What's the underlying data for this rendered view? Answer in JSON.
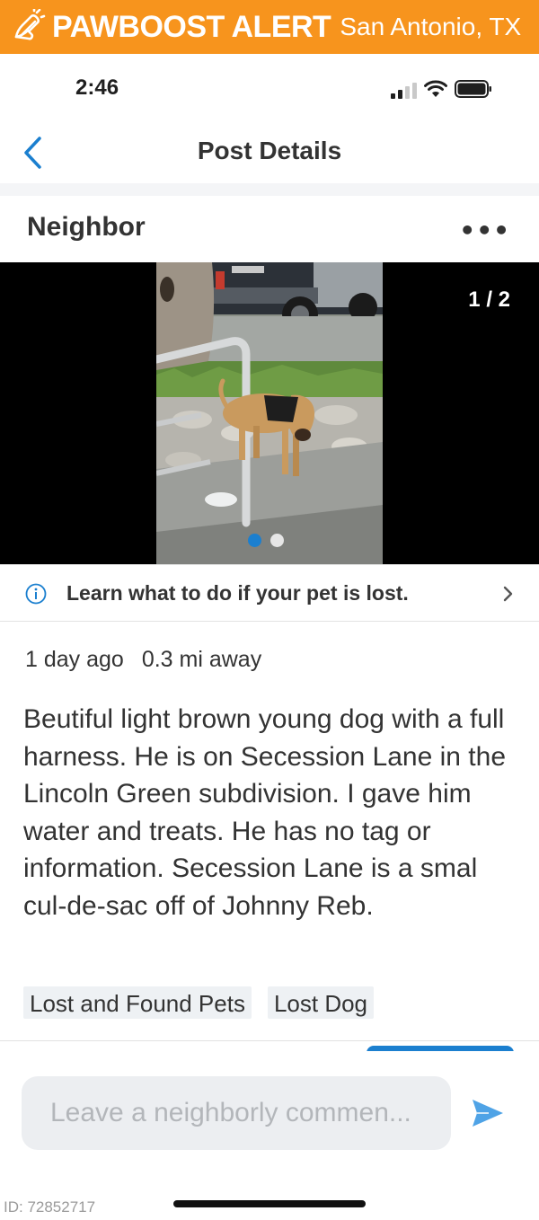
{
  "alert": {
    "brand": "PAWBOOST ALERT",
    "city": "San Antonio, TX",
    "color": "#f7941d",
    "icon": "bell-alert-icon"
  },
  "status_bar": {
    "time": "2:46",
    "icons": [
      "signal-icon",
      "wifi-icon",
      "battery-icon"
    ]
  },
  "nav": {
    "title": "Post Details",
    "back_icon": "chevron-left-icon",
    "accent": "#1b7fcf"
  },
  "post": {
    "author": "Neighbor",
    "more_icon": "more-dots-icon",
    "more_label": "•••",
    "photo": {
      "counter": "1 / 2",
      "total": 2,
      "current": 1
    },
    "learn_link": "Learn what to do if your pet is lost.",
    "time_ago": "1 day ago",
    "distance": "0.3 mi away",
    "body": "Beutiful light brown young dog with a full harness. He is on Secession Lane in the Lincoln Green subdivision. I gave him water and treats. He has no tag or information. Secession Lane is a smal cul-de-sac off of Johnny Reb.",
    "tags": [
      "Lost and Found Pets",
      "Lost Dog"
    ]
  },
  "comment": {
    "placeholder": "Leave a neighborly commen...",
    "send_icon": "send-icon"
  },
  "footer": {
    "post_id": "ID: 72852717"
  }
}
